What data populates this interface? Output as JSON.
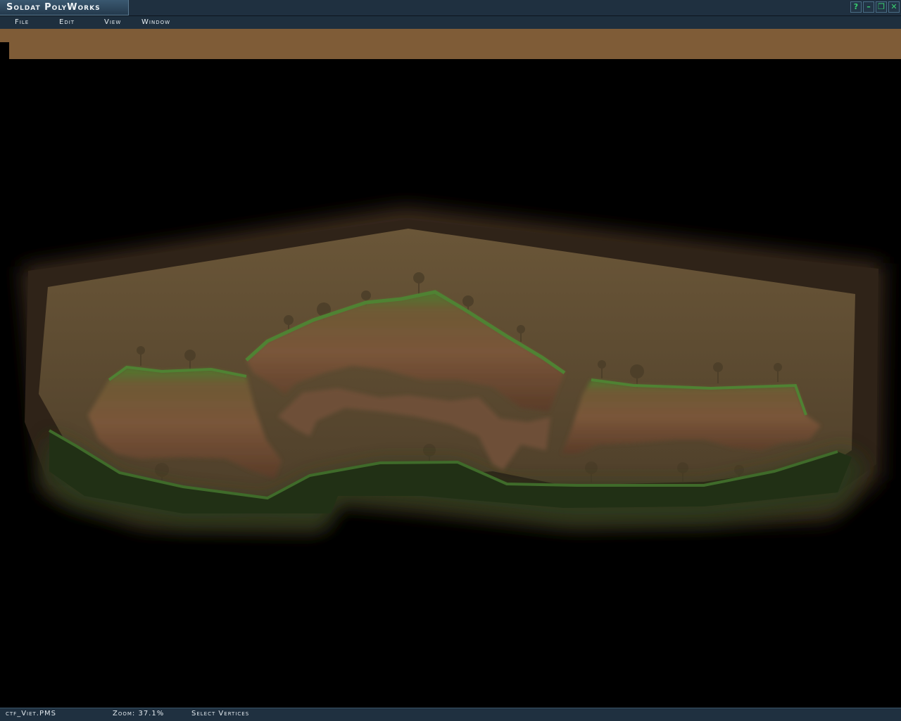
{
  "window": {
    "title": "Soldat PolyWorks",
    "controls": [
      {
        "name": "help-icon",
        "glyph": "?"
      },
      {
        "name": "minimize-icon",
        "glyph": "–"
      },
      {
        "name": "restore-icon",
        "glyph": "❐"
      },
      {
        "name": "close-icon",
        "glyph": "✕"
      }
    ]
  },
  "menu": {
    "file": "File",
    "edit": "Edit",
    "view": "View",
    "window": "Window"
  },
  "status": {
    "filename": "ctf_Viet.PMS",
    "zoom": "Zoom: 37.1%",
    "mode": "Select Vertices"
  },
  "colors": {
    "titlebar": "#1f3040",
    "toolbar_strip": "#7f5c37",
    "map_background": "#5e4a30",
    "dirt": "#6b4a31",
    "grass": "#3d6a2a",
    "accent_green": "#39d070"
  }
}
